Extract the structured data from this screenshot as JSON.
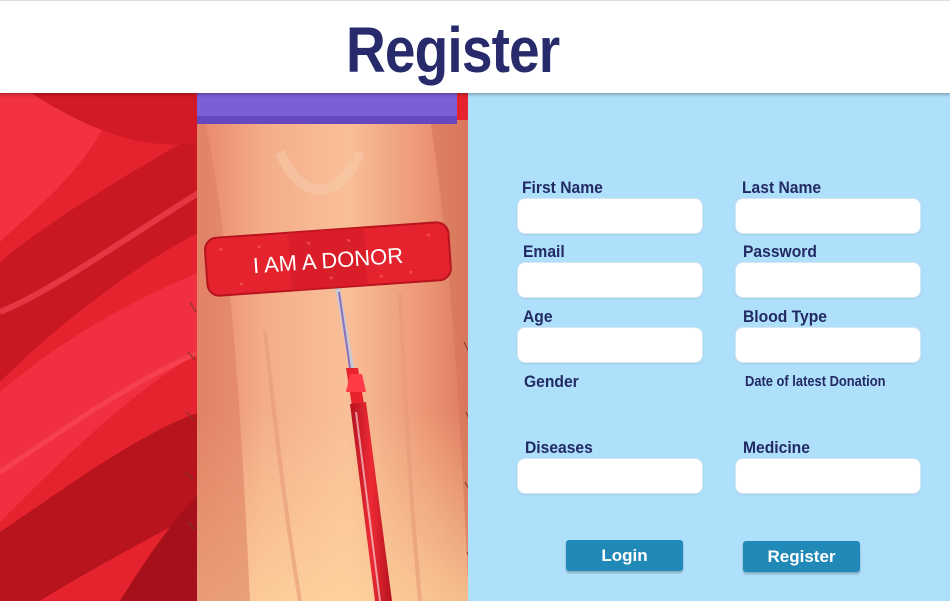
{
  "page_title": "Register",
  "illustration": {
    "bandage_text": "I AM A DONOR"
  },
  "form": {
    "first_name_label": "First Name",
    "last_name_label": "Last Name",
    "email_label": "Email",
    "password_label": "Password",
    "age_label": "Age",
    "blood_type_label": "Blood Type",
    "gender_label": "Gender",
    "donation_date_label": "Date of latest Donation",
    "diseases_label": "Diseases",
    "medicine_label": "Medicine"
  },
  "buttons": {
    "login_label": "Login",
    "register_label": "Register"
  },
  "colors": {
    "title": "#272a6b",
    "panel_bg": "#afe0fb",
    "button_bg": "#2089b8",
    "label": "#222a63"
  }
}
